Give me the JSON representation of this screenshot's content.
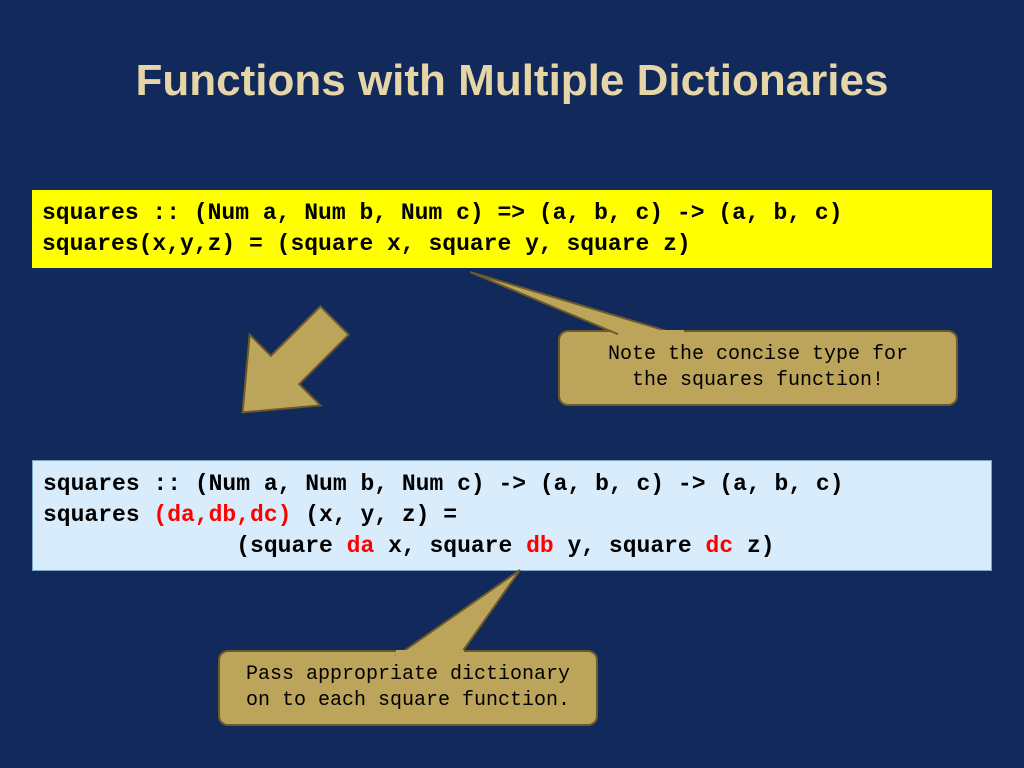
{
  "title": "Functions with Multiple Dictionaries",
  "code1": {
    "line1": "squares :: (Num a, Num b, Num c) => (a, b, c) -> (a, b, c)",
    "line2": "squares(x,y,z) = (square x, square y, square z)"
  },
  "code2": {
    "line1": "squares :: (Num a, Num b, Num c) -> (a, b, c) -> (a, b, c)",
    "l2a": "squares ",
    "l2b": "(da,db,dc)",
    "l2c": " (x, y, z) =",
    "l3a": "              (square ",
    "l3b": "da",
    "l3c": " x, square ",
    "l3d": "db",
    "l3e": " y, square ",
    "l3f": "dc",
    "l3g": " z)"
  },
  "callout1": "Note the concise type for\nthe squares function!",
  "callout2": "Pass appropriate dictionary\non to each square function."
}
